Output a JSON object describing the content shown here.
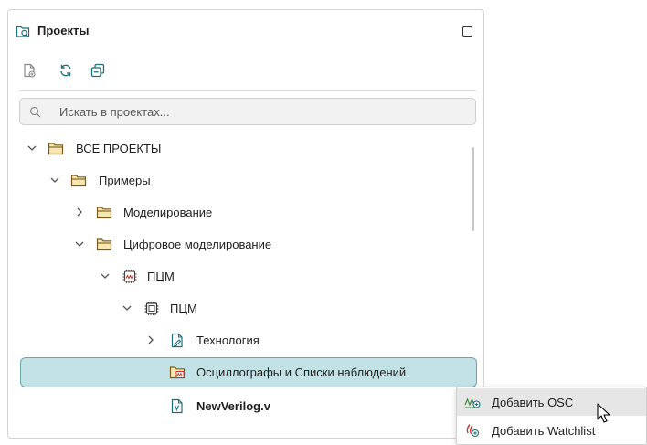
{
  "panel": {
    "title": "Проекты",
    "title_icon": "project-folder-icon",
    "maximize_icon": "maximize-icon"
  },
  "toolbar": {
    "buttons": [
      {
        "icon": "new-document-icon"
      },
      {
        "icon": "refresh-icon"
      },
      {
        "icon": "collapse-all-icon"
      }
    ]
  },
  "search": {
    "placeholder": "Искать в проектах...",
    "icon": "search-icon"
  },
  "tree": {
    "items": [
      {
        "label": "ВСЕ ПРОЕКТЫ",
        "expanded": true,
        "icon": "folder-icon",
        "depth": 0
      },
      {
        "label": "Примеры",
        "expanded": true,
        "icon": "folder-icon",
        "depth": 1
      },
      {
        "label": "Моделирование",
        "expanded": false,
        "icon": "folder-icon",
        "depth": 2
      },
      {
        "label": "Цифровое моделирование",
        "expanded": true,
        "icon": "folder-icon",
        "depth": 2
      },
      {
        "label": "ПЦМ",
        "expanded": true,
        "icon": "waveform-chip-icon",
        "depth": 3
      },
      {
        "label": "ПЦМ",
        "expanded": true,
        "icon": "chip-icon",
        "depth": 4
      },
      {
        "label": "Технология",
        "expanded": false,
        "icon": "technology-document-icon",
        "depth": 5
      },
      {
        "label": "Осциллографы и Списки наблюдений",
        "selected": true,
        "icon": "oscilloscope-folder-icon",
        "depth": 5
      },
      {
        "label": "NewVerilog.v",
        "bold": true,
        "icon": "verilog-file-icon",
        "depth": 5
      }
    ]
  },
  "context_menu": {
    "items": [
      {
        "label": "Добавить OSC",
        "icon": "add-oscilloscope-icon",
        "hovered": true
      },
      {
        "label": "Добавить Watchlist",
        "icon": "add-watchlist-icon"
      }
    ]
  },
  "colors": {
    "selection_bg": "#c3e2e6",
    "selection_border": "#6aa6ad",
    "folder_stroke": "#7a5c1e",
    "folder_fill": "#f7e7b0",
    "accent_teal": "#2f7f86",
    "osc_red": "#c0392b"
  }
}
